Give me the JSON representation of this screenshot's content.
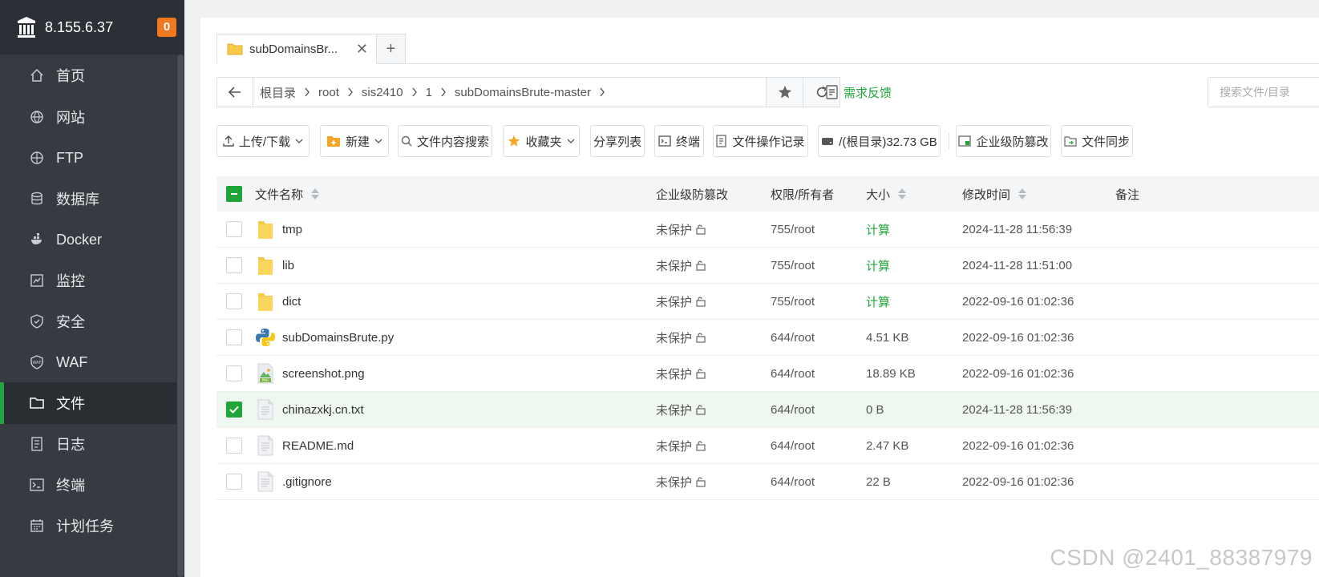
{
  "sidebar": {
    "server_ip": "8.155.6.37",
    "badge_count": "0",
    "items": [
      {
        "label": "首页",
        "icon": "home-icon"
      },
      {
        "label": "网站",
        "icon": "globe-icon"
      },
      {
        "label": "FTP",
        "icon": "ftp-icon"
      },
      {
        "label": "数据库",
        "icon": "database-icon"
      },
      {
        "label": "Docker",
        "icon": "docker-icon"
      },
      {
        "label": "监控",
        "icon": "monitor-icon"
      },
      {
        "label": "安全",
        "icon": "shield-icon"
      },
      {
        "label": "WAF",
        "icon": "waf-icon"
      },
      {
        "label": "文件",
        "icon": "folder-icon"
      },
      {
        "label": "日志",
        "icon": "log-icon"
      },
      {
        "label": "终端",
        "icon": "terminal-icon"
      },
      {
        "label": "计划任务",
        "icon": "calendar-icon"
      }
    ],
    "active_index": 8
  },
  "tabs": {
    "active_tab_label": "subDomainsBr...",
    "add_label": "+"
  },
  "path": {
    "crumbs": [
      "根目录",
      "root",
      "sis2410",
      "1",
      "subDomainsBrute-master"
    ],
    "feedback_label": "需求反馈",
    "search_placeholder": "搜索文件/目录"
  },
  "toolbar": {
    "upload_label": "上传/下载",
    "new_label": "新建",
    "content_search_label": "文件内容搜索",
    "favorites_label": "收藏夹",
    "share_list_label": "分享列表",
    "terminal_label": "终端",
    "op_log_label": "文件操作记录",
    "disk_label": "/(根目录)32.73 GB",
    "tamper_label": "企业级防篡改",
    "sync_label": "文件同步"
  },
  "table": {
    "headers": {
      "name": "文件名称",
      "tamper": "企业级防篡改",
      "perm": "权限/所有者",
      "size": "大小",
      "mtime": "修改时间",
      "note": "备注"
    },
    "rows": [
      {
        "name": "tmp",
        "type": "folder",
        "tamper": "未保护",
        "perm": "755/root",
        "size": "计算",
        "size_is_action": true,
        "mtime": "2024-11-28 11:56:39",
        "checked": false
      },
      {
        "name": "lib",
        "type": "folder",
        "tamper": "未保护",
        "perm": "755/root",
        "size": "计算",
        "size_is_action": true,
        "mtime": "2024-11-28 11:51:00",
        "checked": false
      },
      {
        "name": "dict",
        "type": "folder",
        "tamper": "未保护",
        "perm": "755/root",
        "size": "计算",
        "size_is_action": true,
        "mtime": "2022-09-16 01:02:36",
        "checked": false
      },
      {
        "name": "subDomainsBrute.py",
        "type": "python",
        "tamper": "未保护",
        "perm": "644/root",
        "size": "4.51 KB",
        "size_is_action": false,
        "mtime": "2022-09-16 01:02:36",
        "checked": false
      },
      {
        "name": "screenshot.png",
        "type": "png",
        "tamper": "未保护",
        "perm": "644/root",
        "size": "18.89 KB",
        "size_is_action": false,
        "mtime": "2022-09-16 01:02:36",
        "checked": false
      },
      {
        "name": "chinazxkj.cn.txt",
        "type": "file",
        "tamper": "未保护",
        "perm": "644/root",
        "size": "0 B",
        "size_is_action": false,
        "mtime": "2024-11-28 11:56:39",
        "checked": true
      },
      {
        "name": "README.md",
        "type": "file",
        "tamper": "未保护",
        "perm": "644/root",
        "size": "2.47 KB",
        "size_is_action": false,
        "mtime": "2022-09-16 01:02:36",
        "checked": false
      },
      {
        "name": ".gitignore",
        "type": "file",
        "tamper": "未保护",
        "perm": "644/root",
        "size": "22 B",
        "size_is_action": false,
        "mtime": "2022-09-16 01:02:36",
        "checked": false
      }
    ]
  },
  "colors": {
    "accent": "#20a53a",
    "sidebar_bg": "#363b42",
    "badge": "#f0781e"
  },
  "watermark": "CSDN @2401_88387979"
}
